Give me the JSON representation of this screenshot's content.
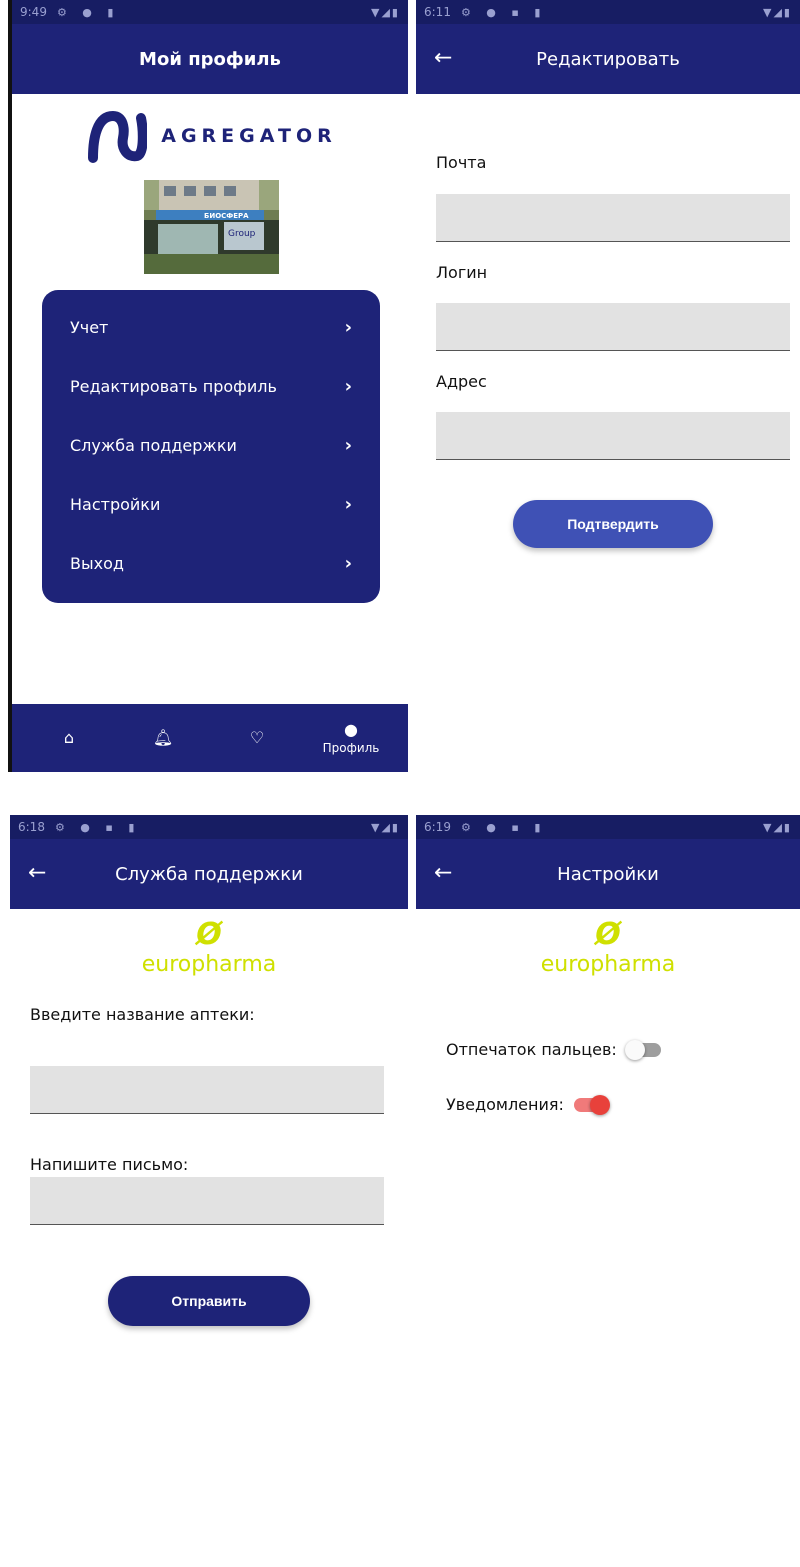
{
  "screens": {
    "profile": {
      "status_time": "9:49",
      "title": "Мой профиль",
      "logo_text": "AGREGATOR",
      "menu": [
        {
          "label": "Учет"
        },
        {
          "label": "Редактировать профиль"
        },
        {
          "label": "Служба поддержки"
        },
        {
          "label": "Настройки"
        },
        {
          "label": "Выход"
        }
      ],
      "nav": {
        "profile_label": "Профиль"
      },
      "photo_sign": "БИОСФЕРА"
    },
    "edit": {
      "status_time": "6:11",
      "title": "Редактировать",
      "fields": [
        {
          "label": "Почта",
          "value": ""
        },
        {
          "label": "Логин",
          "value": ""
        },
        {
          "label": "Адрес",
          "value": ""
        }
      ],
      "confirm_label": "Подтвердить"
    },
    "support": {
      "status_time": "6:18",
      "title": "Служба поддержки",
      "brand": "europharma",
      "pharmacy_label": "Введите название аптеки:",
      "pharmacy_value": "",
      "letter_label": "Напишите письмо:",
      "letter_value": "",
      "send_label": "Отправить"
    },
    "settings": {
      "status_time": "6:19",
      "title": "Настройки",
      "brand": "europharma",
      "fingerprint_label": "Отпечаток пальцев:",
      "fingerprint_on": false,
      "notifications_label": "Уведомления:",
      "notifications_on": true
    }
  },
  "colors": {
    "primary": "#1e2378",
    "statusbar": "#171d63",
    "confirm_button": "#3f51b5",
    "brand_lime": "#cfe000",
    "toggle_on": "#e8413b",
    "input_bg": "#e2e2e2"
  }
}
